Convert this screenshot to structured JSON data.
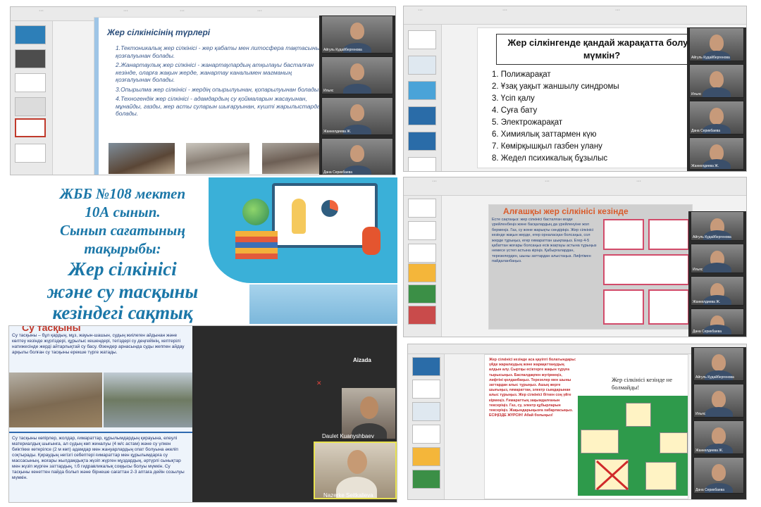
{
  "panel1": {
    "title": "Жер сілкінісінің түрлері",
    "items": [
      "1.Тектоникалық жер сілкінісі - жер қабаты мен литосфера тақтасының қозғалуынан болады.",
      "2.Жанартаулық жер сілкінісі - жанартаулардың атқылауы басталған кезінде, оларға жақын жерде, жанартау каналымен магманың қозғалуынан болады.",
      "3.Опырылма жер сілкінісі - жердің опырылуынан, қопарылуынан болады.",
      "4.Техногендік жер сілкінісі - адамдардың су қоймаларын жасауынан, мұнайды, газды, жер асты суларын шығаруынан, күшті жарылыстардан болады."
    ],
    "participants": [
      "Айгуль Кудайбергенова",
      "Ильяс",
      "Жанкелдиева Ж.",
      "Дана Серикбаева"
    ]
  },
  "panel2": {
    "title": "Жер сілкінгенде қандай жарақатта болуы мүмкін?",
    "items": [
      "1.  Полижарақат",
      "2.  Ұзақ уақыт жаншылу  синдромы",
      "3.  Үсіп қалу",
      "4.  Суға бату",
      "5.  Электрожарақат",
      "6.  Химиялық  заттармен  күю",
      "7.  Көмірқышқыл газбен улану",
      "8.  Жедел психикалық бұзылыс"
    ],
    "participants": [
      "Айгуль Кудайбергенова",
      "Ильяс",
      "Дана Серикбаева",
      "Жанкелдиева Ж."
    ]
  },
  "center": {
    "line1": "ЖББ №108 мектеп",
    "line2": "10А сынып.",
    "line3": "Сынып сағатының",
    "line4": "тақырыбы:",
    "topic1": "Жер сілкінісі",
    "topic2": "және су тасқыны",
    "topic3": "кезіндегі сақтық"
  },
  "panel3": {
    "partial_title": "Су тасқыны",
    "paragraph1": "Су тасқыны – бұл қардың, мұз, жауын-шашын, судың жиілеген айдынан және көлтеу кезінде жүргіздері, құрылыс кешендері, тегіздері су деңгейінің, кептерілі натижесінде жерді айтарлықтай су басу. Өзендер арнасында суды жеппен айдау арқылы болған су тасқыны ерекше түрге жатады.",
    "paragraph2": "Су тасқыны көпірлер, жолдар, ғимараттар, құрылымдардың қирауына, елеулі материалдық шығынға, ал судың көп жиналуы (4 м/с астам) және су үлкен биіктікке көтерілсе (2 м көп) адамдар мен жануарлардың опат болуына әкеліп соқтырады. Қираудың негізгі себептері ғимараттар мен құрылымдарға су массасының, жоғары жылдамдықта жүзіп жүрген мұздардың, әртүрлі сынықтар мен жүзіп жүрген заттардың, т.б гидравликалық соққысы болуы мүмкін. Су тасқыны кенеттен пайда болып және бірнеше сағаттан 2-3 аптаға дейін созылуы мүмкін.",
    "zoom_name_top": "Aizada",
    "participant1": "Daulet Kuanyshbaev",
    "participant2": "Nazerke Seitkalieva"
  },
  "panel4": {
    "title": "Алғашқы жер сілкінісі кезінде",
    "text": "Есте сақтаңыз: жер сілкінісі басталған кезде үрейленбеңіз және басқалардың да үрейленуіне жол бермеңіз. Газ, су және жарықты сөндіріңіз. Жер сілкінісі кезінде жақын жерде, егер орналасқан болсаңыз, сол жерде тұрыңыз, егер ғимараттан шықпаңыз. Егер 4-5 қабаттан жоғары болсаңыз есік жақтауы астына тұрыңыз немесе үстел астына кіріңіз. Қабырғалардан, терезелерден, шыны заттардан алыстаңыз. Лифтімен пайдаланбаңыз.",
    "participants": [
      "Айгуль Кудайбергенова",
      "Ильяс",
      "Жанкелдиева Ж.",
      "Дана Серикбаева"
    ]
  },
  "panel5": {
    "title": "Жер сілкінісі кезінде не болмайды!",
    "text": "Жер сілкінісі кезінде аса қауіпті болатындары: үйде жаралаудың және жарақаттанудың алдын алу. Сыртқы есіктерге жақын тұруға тырысыңыз. Баспалдақпен жүгірмеңіз, лифтіні қолданбаңыз. Терезелер мен шыны заттардан алыс тұрыңыз. Ашық жерге шығыңыз, ғимараттан, электр сымдарынан алыс тұрыңыз. Жер сілкінісі біткен соң үйге кірмеңіз. Ғимараттың зақымдалғанын тексеріңіз. Газ, су, электр құбырларын тексеріңіз. Жақындарыңызға хабарласыңыз. ЕСІҢІЗДЕ ЖҮРСІН! Абай болыңыз!",
    "participants": [
      "Айгуль Кудайбергенова",
      "Ильяс",
      "Жанкелдиева Ж.",
      "Дана Серикбаева"
    ]
  },
  "colors": {
    "slide_blue_text": "#3b5a8c",
    "title_blue": "#1b77a8",
    "alert_red": "#c0282b",
    "green_board": "#2e9a4b",
    "zoom_dark": "#2b2b2b"
  }
}
